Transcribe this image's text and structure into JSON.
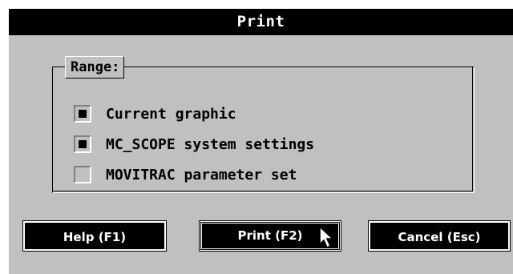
{
  "window": {
    "title": "Print"
  },
  "range": {
    "legend": "Range:",
    "options": [
      {
        "label": "Current graphic",
        "checked": true
      },
      {
        "label": "MC_SCOPE system settings",
        "checked": true
      },
      {
        "label": "MOVITRAC parameter set",
        "checked": false
      }
    ]
  },
  "buttons": {
    "help_label": "Help (F1)",
    "print_label": "Print (F2)",
    "cancel_label": "Cancel (Esc)"
  },
  "icons": {
    "cursor": "mouse-pointer-icon"
  },
  "colors": {
    "dialog_background": "#c0c0c0",
    "title_bar": "#000000",
    "button_background": "#000000",
    "button_text": "#ffffff"
  }
}
